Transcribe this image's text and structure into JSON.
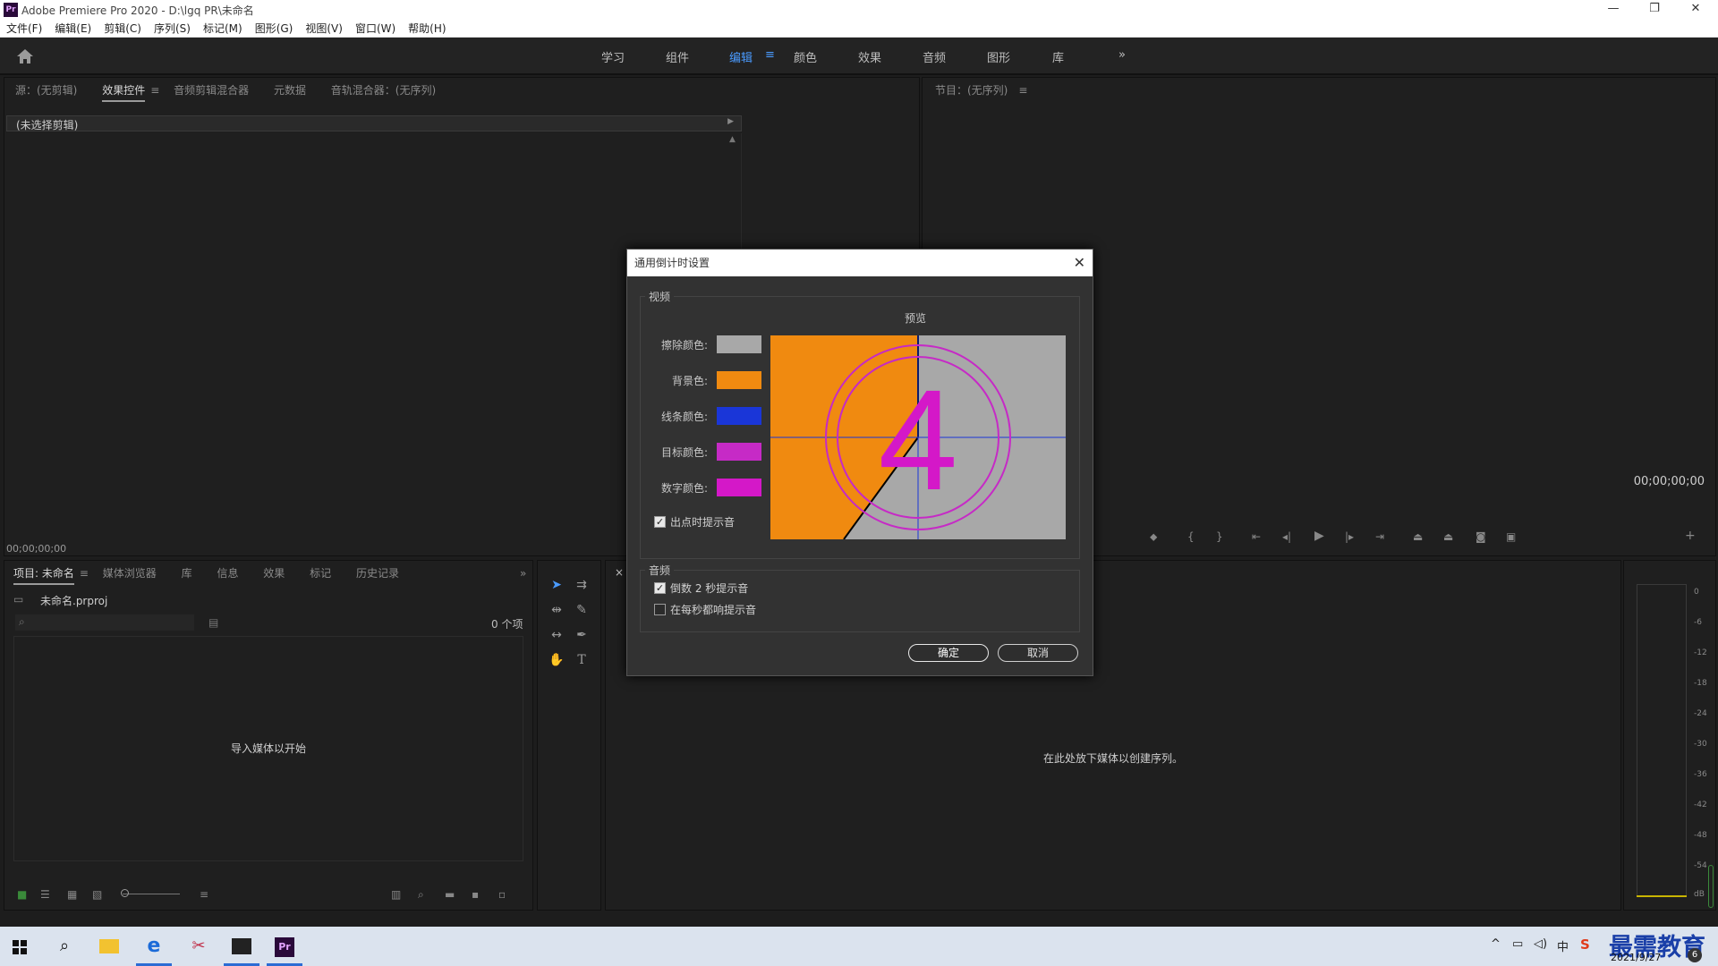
{
  "window": {
    "title": "Adobe Premiere Pro 2020 - D:\\lgq PR\\未命名",
    "app_icon_text": "Pr",
    "controls": [
      "—",
      "❐",
      "✕"
    ]
  },
  "menu": [
    "文件(F)",
    "编辑(E)",
    "剪辑(C)",
    "序列(S)",
    "标记(M)",
    "图形(G)",
    "视图(V)",
    "窗口(W)",
    "帮助(H)"
  ],
  "workspace_tabs": {
    "items": [
      "学习",
      "组件",
      "编辑",
      "颜色",
      "效果",
      "音频",
      "图形",
      "库"
    ],
    "active": "编辑",
    "overflow": "»"
  },
  "source_panel": {
    "tabs": [
      "源：(无剪辑)",
      "效果控件",
      "音频剪辑混合器",
      "元数据",
      "音轨混合器：(无序列)"
    ],
    "active_tab": "效果控件",
    "clip_label": "(未选择剪辑)",
    "timecode": "00;00;00;00"
  },
  "program_panel": {
    "tab": "节目：(无序列)",
    "timecode": "00;00;00;00"
  },
  "project_panel": {
    "tabs": [
      "项目: 未命名",
      "媒体浏览器",
      "库",
      "信息",
      "效果",
      "标记",
      "历史记录"
    ],
    "file": "未命名.prproj",
    "item_count": "0 个项",
    "empty_hint": "导入媒体以开始"
  },
  "timeline_panel": {
    "empty_hint": "在此处放下媒体以创建序列。",
    "close": "×"
  },
  "audio_meter": {
    "ticks": [
      "0",
      "-6",
      "-12",
      "-18",
      "-24",
      "-30",
      "-36",
      "-42",
      "-48",
      "-54",
      "dB"
    ]
  },
  "dialog": {
    "title": "通用倒计时设置",
    "video_group": "视频",
    "preview_label": "预览",
    "preview_number": "4",
    "colors": [
      {
        "label": "擦除颜色:",
        "color": "#a8a8a8"
      },
      {
        "label": "背景色:",
        "color": "#f08a10"
      },
      {
        "label": "线条颜色:",
        "color": "#1a36d8"
      },
      {
        "label": "目标颜色:",
        "color": "#c62ac6"
      },
      {
        "label": "数字颜色:",
        "color": "#d418c8"
      }
    ],
    "cue_at_out": {
      "label": "出点时提示音",
      "checked": true
    },
    "audio_group": "音频",
    "beep_2s": {
      "label": "倒数 2 秒提示音",
      "checked": true
    },
    "beep_each": {
      "label": "在每秒都响提示音",
      "checked": false
    },
    "ok": "确定",
    "cancel": "取消"
  },
  "taskbar": {
    "date": "2021/9/27",
    "watermark": "最需教育",
    "notification_count": "6"
  }
}
